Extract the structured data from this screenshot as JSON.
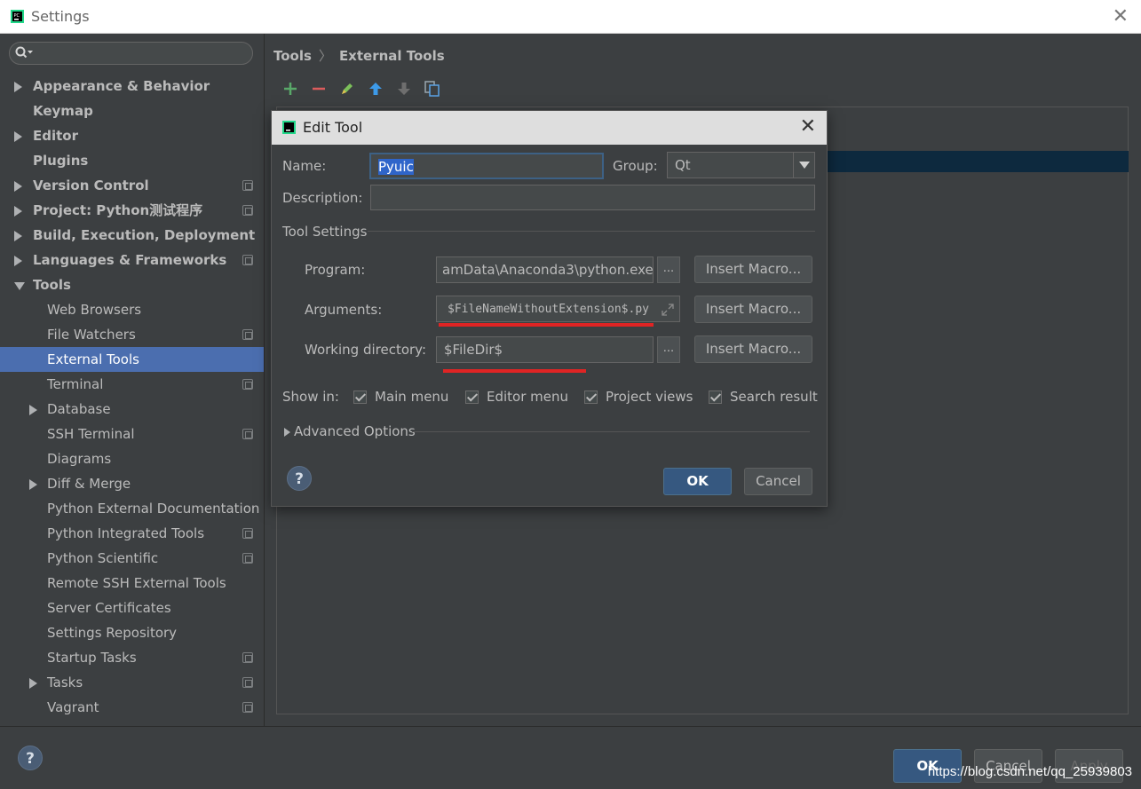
{
  "window": {
    "title": "Settings"
  },
  "search": {
    "placeholder": ""
  },
  "sidebar": {
    "items": [
      {
        "label": "Appearance & Behavior",
        "level": 0,
        "arrow": "right",
        "proj": false
      },
      {
        "label": "Keymap",
        "level": 0,
        "arrow": "none",
        "proj": false
      },
      {
        "label": "Editor",
        "level": 0,
        "arrow": "right",
        "proj": false
      },
      {
        "label": "Plugins",
        "level": 0,
        "arrow": "none",
        "proj": false
      },
      {
        "label": "Version Control",
        "level": 0,
        "arrow": "right",
        "proj": true
      },
      {
        "label": "Project: Python测试程序",
        "level": 0,
        "arrow": "right",
        "proj": true
      },
      {
        "label": "Build, Execution, Deployment",
        "level": 0,
        "arrow": "right",
        "proj": false
      },
      {
        "label": "Languages & Frameworks",
        "level": 0,
        "arrow": "right",
        "proj": true
      },
      {
        "label": "Tools",
        "level": 0,
        "arrow": "down",
        "proj": false
      },
      {
        "label": "Web Browsers",
        "level": 1,
        "arrow": "none",
        "proj": false
      },
      {
        "label": "File Watchers",
        "level": 1,
        "arrow": "none",
        "proj": true
      },
      {
        "label": "External Tools",
        "level": 1,
        "arrow": "none",
        "proj": false,
        "selected": true
      },
      {
        "label": "Terminal",
        "level": 1,
        "arrow": "none",
        "proj": true
      },
      {
        "label": "Database",
        "level": 1,
        "arrow": "right",
        "proj": false
      },
      {
        "label": "SSH Terminal",
        "level": 1,
        "arrow": "none",
        "proj": true
      },
      {
        "label": "Diagrams",
        "level": 1,
        "arrow": "none",
        "proj": false
      },
      {
        "label": "Diff & Merge",
        "level": 1,
        "arrow": "right",
        "proj": false
      },
      {
        "label": "Python External Documentation",
        "level": 1,
        "arrow": "none",
        "proj": false
      },
      {
        "label": "Python Integrated Tools",
        "level": 1,
        "arrow": "none",
        "proj": true
      },
      {
        "label": "Python Scientific",
        "level": 1,
        "arrow": "none",
        "proj": true
      },
      {
        "label": "Remote SSH External Tools",
        "level": 1,
        "arrow": "none",
        "proj": false
      },
      {
        "label": "Server Certificates",
        "level": 1,
        "arrow": "none",
        "proj": false
      },
      {
        "label": "Settings Repository",
        "level": 1,
        "arrow": "none",
        "proj": false
      },
      {
        "label": "Startup Tasks",
        "level": 1,
        "arrow": "none",
        "proj": true
      },
      {
        "label": "Tasks",
        "level": 1,
        "arrow": "right",
        "proj": true
      },
      {
        "label": "Vagrant",
        "level": 1,
        "arrow": "none",
        "proj": true
      }
    ]
  },
  "breadcrumb": {
    "parent": "Tools",
    "separator": "〉",
    "current": "External Tools"
  },
  "toolbar": {
    "icons": [
      "add-icon",
      "remove-icon",
      "edit-icon",
      "move-up-icon",
      "move-down-icon",
      "copy-icon"
    ]
  },
  "dialog": {
    "title": "Edit Tool",
    "name_label": "Name:",
    "name_value": "Pyuic",
    "group_label": "Group:",
    "group_value": "Qt",
    "description_label": "Description:",
    "description_value": "",
    "tool_settings_label": "Tool Settings",
    "program_label": "Program:",
    "program_value": "amData\\Anaconda3\\python.exe",
    "arguments_label": "Arguments:",
    "arguments_value": "$FileNameWithoutExtension$.py",
    "workdir_label": "Working directory:",
    "workdir_value": "$FileDir$",
    "browse_label": "...",
    "insert_macro_label": "Insert Macro...",
    "show_in_label": "Show in:",
    "checkboxes": [
      {
        "label": "Main menu",
        "checked": true
      },
      {
        "label": "Editor menu",
        "checked": true
      },
      {
        "label": "Project views",
        "checked": true
      },
      {
        "label": "Search result",
        "checked": true
      }
    ],
    "advanced_label": "Advanced Options",
    "help_label": "?",
    "ok_label": "OK",
    "cancel_label": "Cancel"
  },
  "footer": {
    "help_label": "?",
    "ok_label": "OK",
    "cancel_label": "Cancel",
    "apply_label": "Apply"
  },
  "watermark": "https://blog.csdn.net/qq_25939803",
  "colors": {
    "background": "#3c3f41",
    "selection": "#4b6eaf",
    "default_button": "#365880",
    "annotation_red": "#e02424"
  }
}
